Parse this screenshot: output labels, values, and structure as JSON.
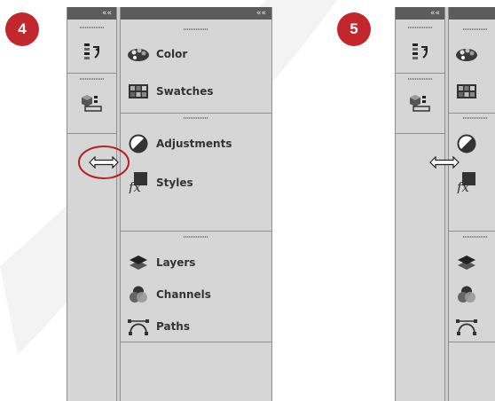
{
  "steps": [
    {
      "number": "4"
    },
    {
      "number": "5"
    }
  ],
  "dock": {
    "collapse_glyph": "««",
    "icon_strip": [
      {
        "icon": "history-icon"
      },
      {
        "icon": "3d-tools-icon"
      }
    ],
    "panels": [
      {
        "label": "Color",
        "icon": "color-palette-icon"
      },
      {
        "label": "Swatches",
        "icon": "swatches-icon"
      },
      {
        "label": "Adjustments",
        "icon": "adjustments-icon"
      },
      {
        "label": "Styles",
        "icon": "styles-icon"
      },
      {
        "label": "Layers",
        "icon": "layers-icon"
      },
      {
        "label": "Channels",
        "icon": "channels-icon"
      },
      {
        "label": "Paths",
        "icon": "paths-icon"
      }
    ]
  },
  "colors": {
    "badge": "#c1272d",
    "highlight_ellipse": "#b22222",
    "dock_background": "#d6d6d6",
    "dock_header": "#5c5c5c"
  }
}
